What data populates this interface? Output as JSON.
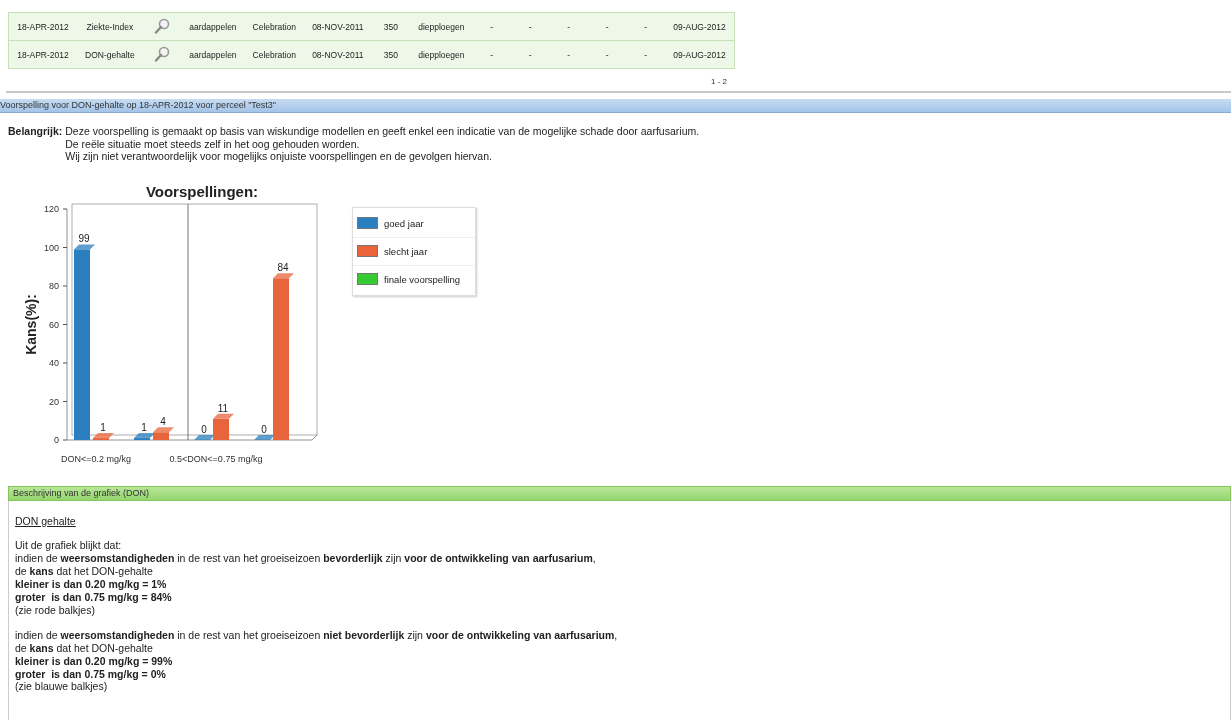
{
  "table": {
    "rows": [
      {
        "cells": [
          {
            "kind": "text",
            "text": "18-APR-2012"
          },
          {
            "kind": "text",
            "text": "Ziekte-Index"
          },
          {
            "kind": "search"
          },
          {
            "kind": "text",
            "text": "aardappelen"
          },
          {
            "kind": "text",
            "text": "Celebration"
          },
          {
            "kind": "text",
            "text": "08-NOV-2011"
          },
          {
            "kind": "text",
            "text": "350"
          },
          {
            "kind": "text",
            "text": "diepploegen"
          },
          {
            "kind": "text",
            "text": "-"
          },
          {
            "kind": "text",
            "text": "-"
          },
          {
            "kind": "text",
            "text": "-"
          },
          {
            "kind": "text",
            "text": "-"
          },
          {
            "kind": "text",
            "text": "-"
          },
          {
            "kind": "text",
            "text": "09-AUG-2012"
          }
        ]
      },
      {
        "cells": [
          {
            "kind": "text",
            "text": "18-APR-2012"
          },
          {
            "kind": "text",
            "text": "DON-gehalte"
          },
          {
            "kind": "search"
          },
          {
            "kind": "text",
            "text": "aardappelen"
          },
          {
            "kind": "text",
            "text": "Celebration"
          },
          {
            "kind": "text",
            "text": "08-NOV-2011"
          },
          {
            "kind": "text",
            "text": "350"
          },
          {
            "kind": "text",
            "text": "diepploegen"
          },
          {
            "kind": "text",
            "text": "-"
          },
          {
            "kind": "text",
            "text": "-"
          },
          {
            "kind": "text",
            "text": "-"
          },
          {
            "kind": "text",
            "text": "-"
          },
          {
            "kind": "text",
            "text": "-"
          },
          {
            "kind": "text",
            "text": "09-AUG-2012"
          }
        ]
      }
    ],
    "pager": "1 - 2"
  },
  "forecast": {
    "title": "Voorspelling voor DON-gehalte op 18-APR-2012 voor perceel \"Test3\"",
    "notice_label": "Belangrijk:",
    "notice_lines": [
      "Deze voorspelling is gemaakt op basis van wiskundige modellen en geeft enkel een indicatie van de mogelijke schade door aarfusarium.",
      "De reële situatie moet steeds zelf in het oog gehouden worden.",
      "Wij zijn niet verantwoordelijk voor mogelijks onjuiste voorspellingen en de gevolgen hiervan."
    ],
    "chart_data": {
      "type": "bar",
      "title": "Voorspellingen:",
      "ylabel": "Kans(%):",
      "categories": [
        "DON<=0.2 mg/kg",
        null,
        "0.5<DON<=0.75 mg/kg",
        null
      ],
      "ylim": [
        0,
        120
      ],
      "yticks": [
        0,
        20,
        40,
        60,
        80,
        100,
        120
      ],
      "data_labels": true,
      "series": [
        {
          "name": "goed jaar",
          "color": "#2a7fc0",
          "values": [
            99,
            1,
            0,
            0
          ]
        },
        {
          "name": "slecht jaar",
          "color": "#e8643a",
          "values": [
            1,
            4,
            11,
            84
          ]
        },
        {
          "name": "finale voorspelling",
          "color": "#33cc33",
          "values": [
            null,
            null,
            null,
            null
          ]
        }
      ]
    }
  },
  "description": {
    "title": "Beschrijving van de grafiek (DON)",
    "heading": "DON gehalte",
    "paragraphs": [
      [
        {
          "text": "Uit de grafiek blijkt dat:",
          "bold": false
        },
        {
          "text": "indien de **weersomstandigheden** in de rest van het groeiseizoen **bevorderlijk** zijn **voor de ontwikkeling van aarfusarium**,",
          "bold": false
        },
        {
          "text": "de **kans** dat het DON-gehalte",
          "bold": false
        },
        {
          "text": "kleiner is dan 0.20 mg/kg = 1%",
          "bold": true
        },
        {
          "text": "groter  is dan 0.75 mg/kg = 84%",
          "bold": true
        },
        {
          "text": "(zie rode balkjes)",
          "bold": false
        }
      ],
      [
        {
          "text": "indien de **weersomstandigheden** in de rest van het groeiseizoen **niet bevorderlijk** zijn **voor de ontwikkeling van aarfusarium**,",
          "bold": false
        },
        {
          "text": "de **kans** dat het DON-gehalte",
          "bold": false
        },
        {
          "text": "kleiner is dan 0.20 mg/kg = 99%",
          "bold": true
        },
        {
          "text": "groter  is dan 0.75 mg/kg = 0%",
          "bold": true
        },
        {
          "text": "(zie blauwe balkjes)",
          "bold": false
        }
      ]
    ]
  }
}
